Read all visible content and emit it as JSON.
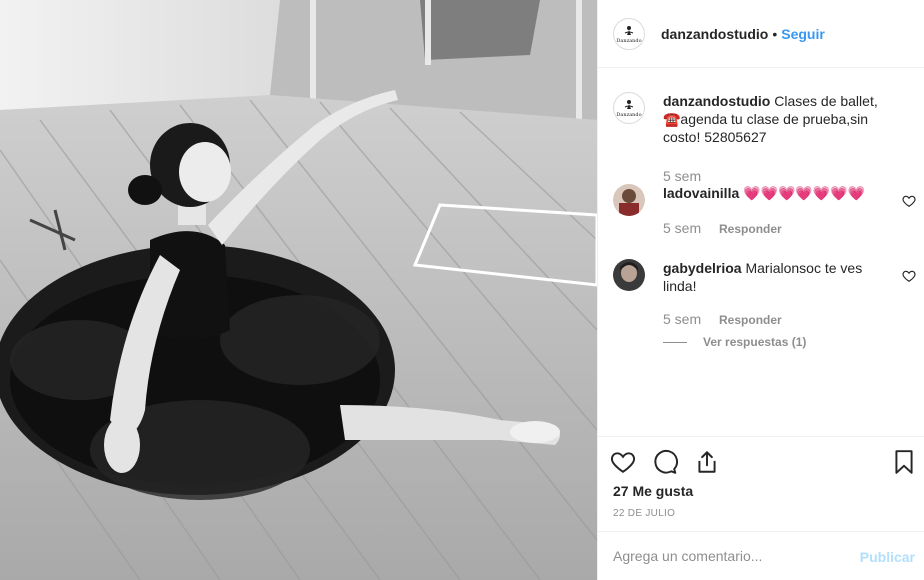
{
  "post": {
    "username": "danzandostudio",
    "separator": "•",
    "follow_label": "Seguir",
    "logo_text": "Danzando",
    "photo_alt": "Bailarina con tutú negro sentada en el piso del estudio"
  },
  "caption": {
    "username": "danzandostudio",
    "text": "Clases de ballet, ☎️agenda tu clase de prueba,sin costo! 52805627",
    "time": "5 sem"
  },
  "comments": [
    {
      "username": "ladovainilla",
      "text": "💗💗💗💗💗💗💗",
      "time": "5 sem",
      "reply_label": "Responder"
    },
    {
      "username": "gabydelrioa",
      "text": "Marialonsoc te ves linda!",
      "time": "5 sem",
      "reply_label": "Responder"
    }
  ],
  "view_replies": "Ver respuestas (1)",
  "likes": "27 Me gusta",
  "date": "22 DE JULIO",
  "composer": {
    "placeholder": "Agrega un comentario...",
    "post_label": "Publicar"
  },
  "colors": {
    "link_blue": "#3897f0",
    "post_disabled": "#b2dffc",
    "muted": "#8e8e8e",
    "border": "#efefef"
  },
  "icons": [
    "like-heart-icon",
    "comment-bubble-icon",
    "share-icon",
    "bookmark-icon",
    "small-heart-icon"
  ]
}
